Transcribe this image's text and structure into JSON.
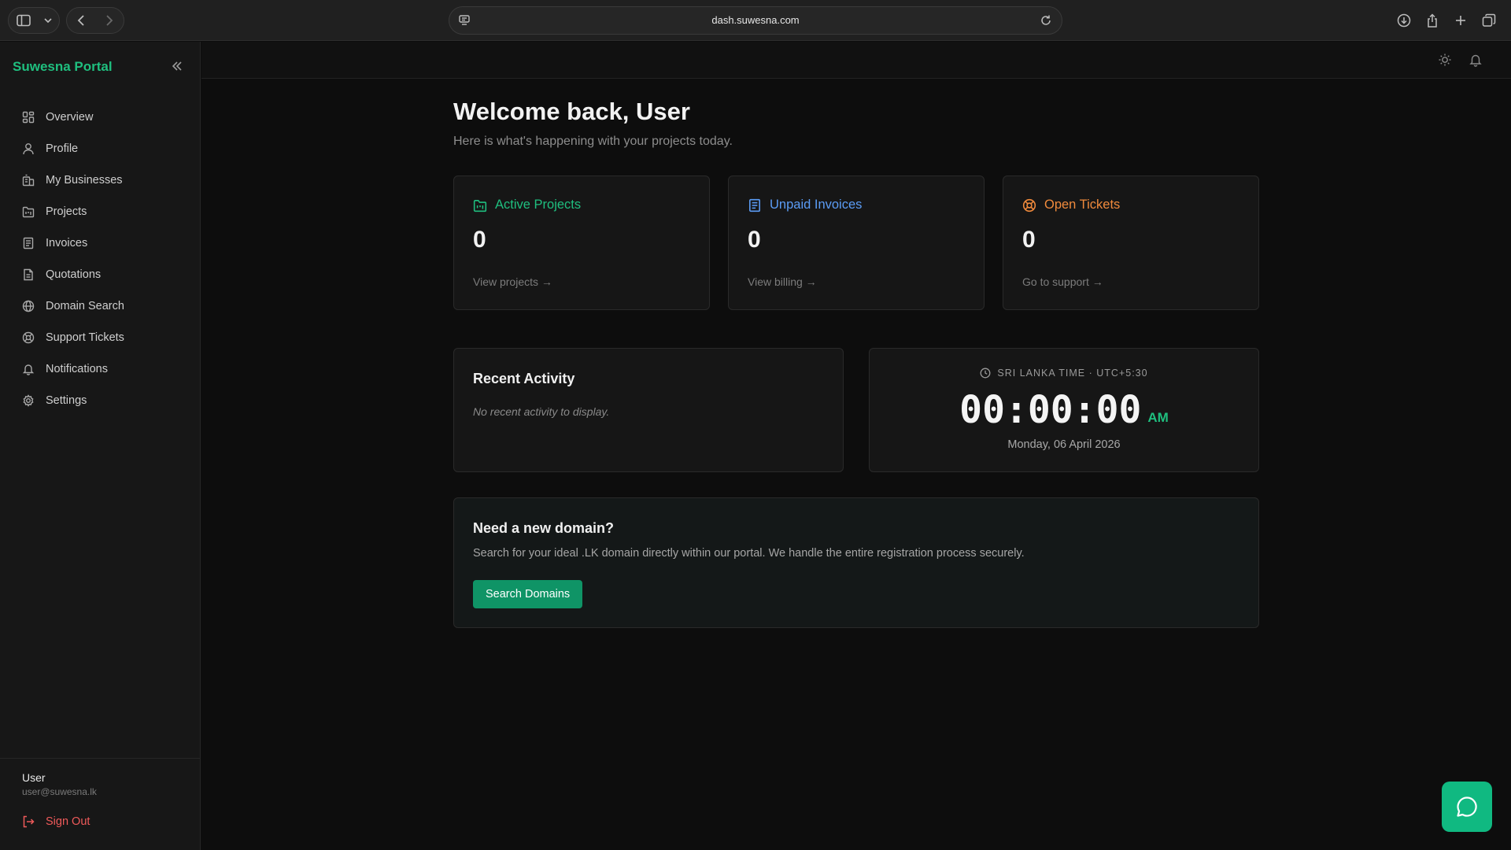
{
  "browser": {
    "url": "dash.suwesna.com",
    "icons": [
      "sidebar-toggle-icon",
      "chevron-down-icon",
      "back-icon",
      "forward-icon",
      "site-settings-icon",
      "reload-icon",
      "download-icon",
      "share-icon",
      "new-tab-icon",
      "tabs-overview-icon"
    ]
  },
  "sidebar": {
    "brand": "Suwesna Portal",
    "items": [
      {
        "label": "Overview",
        "icon": "grid-icon"
      },
      {
        "label": "Profile",
        "icon": "user-icon"
      },
      {
        "label": "My Businesses",
        "icon": "building-icon"
      },
      {
        "label": "Projects",
        "icon": "folder-kanban-icon"
      },
      {
        "label": "Invoices",
        "icon": "receipt-icon"
      },
      {
        "label": "Quotations",
        "icon": "file-text-icon"
      },
      {
        "label": "Domain Search",
        "icon": "globe-icon"
      },
      {
        "label": "Support Tickets",
        "icon": "life-buoy-icon"
      },
      {
        "label": "Notifications",
        "icon": "bell-icon"
      },
      {
        "label": "Settings",
        "icon": "gear-icon"
      }
    ],
    "user": {
      "name": "User",
      "email": "user@suwesna.lk"
    },
    "signout_label": "Sign Out"
  },
  "main": {
    "title": "Welcome back, User",
    "subtitle": "Here is what's happening with your projects today.",
    "stats": [
      {
        "label": "Active Projects",
        "value": "0",
        "link": "View projects →",
        "color": "#1fbf7f"
      },
      {
        "label": "Unpaid Invoices",
        "value": "0",
        "link": "View billing →",
        "color": "#5b9cf5"
      },
      {
        "label": "Open Tickets",
        "value": "0",
        "link": "Go to support →",
        "color": "#f08a3c"
      }
    ],
    "recent": {
      "title": "Recent Activity",
      "empty": "No recent activity to display."
    },
    "clock": {
      "label": "SRI LANKA TIME · UTC+5:30",
      "time": "00:00:00",
      "ampm": "AM",
      "date": "Monday, 06 April 2026"
    },
    "promo": {
      "title": "Need a new domain?",
      "text": "Search for your ideal .LK domain directly within our portal. We handle the entire registration process securely.",
      "button": "Search Domains"
    }
  },
  "colors": {
    "accent": "#1fbf7f",
    "danger": "#ef5a5a",
    "fab": "#10b981"
  }
}
